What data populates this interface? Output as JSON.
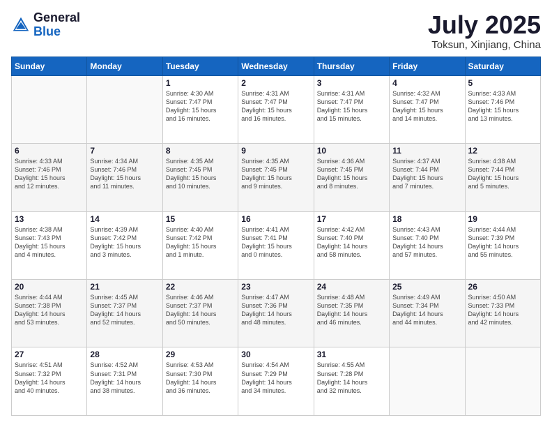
{
  "header": {
    "logo_general": "General",
    "logo_blue": "Blue",
    "month": "July 2025",
    "location": "Toksun, Xinjiang, China"
  },
  "days_of_week": [
    "Sunday",
    "Monday",
    "Tuesday",
    "Wednesday",
    "Thursday",
    "Friday",
    "Saturday"
  ],
  "weeks": [
    [
      {
        "num": "",
        "info": ""
      },
      {
        "num": "",
        "info": ""
      },
      {
        "num": "1",
        "info": "Sunrise: 4:30 AM\nSunset: 7:47 PM\nDaylight: 15 hours\nand 16 minutes."
      },
      {
        "num": "2",
        "info": "Sunrise: 4:31 AM\nSunset: 7:47 PM\nDaylight: 15 hours\nand 16 minutes."
      },
      {
        "num": "3",
        "info": "Sunrise: 4:31 AM\nSunset: 7:47 PM\nDaylight: 15 hours\nand 15 minutes."
      },
      {
        "num": "4",
        "info": "Sunrise: 4:32 AM\nSunset: 7:47 PM\nDaylight: 15 hours\nand 14 minutes."
      },
      {
        "num": "5",
        "info": "Sunrise: 4:33 AM\nSunset: 7:46 PM\nDaylight: 15 hours\nand 13 minutes."
      }
    ],
    [
      {
        "num": "6",
        "info": "Sunrise: 4:33 AM\nSunset: 7:46 PM\nDaylight: 15 hours\nand 12 minutes."
      },
      {
        "num": "7",
        "info": "Sunrise: 4:34 AM\nSunset: 7:46 PM\nDaylight: 15 hours\nand 11 minutes."
      },
      {
        "num": "8",
        "info": "Sunrise: 4:35 AM\nSunset: 7:45 PM\nDaylight: 15 hours\nand 10 minutes."
      },
      {
        "num": "9",
        "info": "Sunrise: 4:35 AM\nSunset: 7:45 PM\nDaylight: 15 hours\nand 9 minutes."
      },
      {
        "num": "10",
        "info": "Sunrise: 4:36 AM\nSunset: 7:45 PM\nDaylight: 15 hours\nand 8 minutes."
      },
      {
        "num": "11",
        "info": "Sunrise: 4:37 AM\nSunset: 7:44 PM\nDaylight: 15 hours\nand 7 minutes."
      },
      {
        "num": "12",
        "info": "Sunrise: 4:38 AM\nSunset: 7:44 PM\nDaylight: 15 hours\nand 5 minutes."
      }
    ],
    [
      {
        "num": "13",
        "info": "Sunrise: 4:38 AM\nSunset: 7:43 PM\nDaylight: 15 hours\nand 4 minutes."
      },
      {
        "num": "14",
        "info": "Sunrise: 4:39 AM\nSunset: 7:42 PM\nDaylight: 15 hours\nand 3 minutes."
      },
      {
        "num": "15",
        "info": "Sunrise: 4:40 AM\nSunset: 7:42 PM\nDaylight: 15 hours\nand 1 minute."
      },
      {
        "num": "16",
        "info": "Sunrise: 4:41 AM\nSunset: 7:41 PM\nDaylight: 15 hours\nand 0 minutes."
      },
      {
        "num": "17",
        "info": "Sunrise: 4:42 AM\nSunset: 7:40 PM\nDaylight: 14 hours\nand 58 minutes."
      },
      {
        "num": "18",
        "info": "Sunrise: 4:43 AM\nSunset: 7:40 PM\nDaylight: 14 hours\nand 57 minutes."
      },
      {
        "num": "19",
        "info": "Sunrise: 4:44 AM\nSunset: 7:39 PM\nDaylight: 14 hours\nand 55 minutes."
      }
    ],
    [
      {
        "num": "20",
        "info": "Sunrise: 4:44 AM\nSunset: 7:38 PM\nDaylight: 14 hours\nand 53 minutes."
      },
      {
        "num": "21",
        "info": "Sunrise: 4:45 AM\nSunset: 7:37 PM\nDaylight: 14 hours\nand 52 minutes."
      },
      {
        "num": "22",
        "info": "Sunrise: 4:46 AM\nSunset: 7:37 PM\nDaylight: 14 hours\nand 50 minutes."
      },
      {
        "num": "23",
        "info": "Sunrise: 4:47 AM\nSunset: 7:36 PM\nDaylight: 14 hours\nand 48 minutes."
      },
      {
        "num": "24",
        "info": "Sunrise: 4:48 AM\nSunset: 7:35 PM\nDaylight: 14 hours\nand 46 minutes."
      },
      {
        "num": "25",
        "info": "Sunrise: 4:49 AM\nSunset: 7:34 PM\nDaylight: 14 hours\nand 44 minutes."
      },
      {
        "num": "26",
        "info": "Sunrise: 4:50 AM\nSunset: 7:33 PM\nDaylight: 14 hours\nand 42 minutes."
      }
    ],
    [
      {
        "num": "27",
        "info": "Sunrise: 4:51 AM\nSunset: 7:32 PM\nDaylight: 14 hours\nand 40 minutes."
      },
      {
        "num": "28",
        "info": "Sunrise: 4:52 AM\nSunset: 7:31 PM\nDaylight: 14 hours\nand 38 minutes."
      },
      {
        "num": "29",
        "info": "Sunrise: 4:53 AM\nSunset: 7:30 PM\nDaylight: 14 hours\nand 36 minutes."
      },
      {
        "num": "30",
        "info": "Sunrise: 4:54 AM\nSunset: 7:29 PM\nDaylight: 14 hours\nand 34 minutes."
      },
      {
        "num": "31",
        "info": "Sunrise: 4:55 AM\nSunset: 7:28 PM\nDaylight: 14 hours\nand 32 minutes."
      },
      {
        "num": "",
        "info": ""
      },
      {
        "num": "",
        "info": ""
      }
    ]
  ]
}
